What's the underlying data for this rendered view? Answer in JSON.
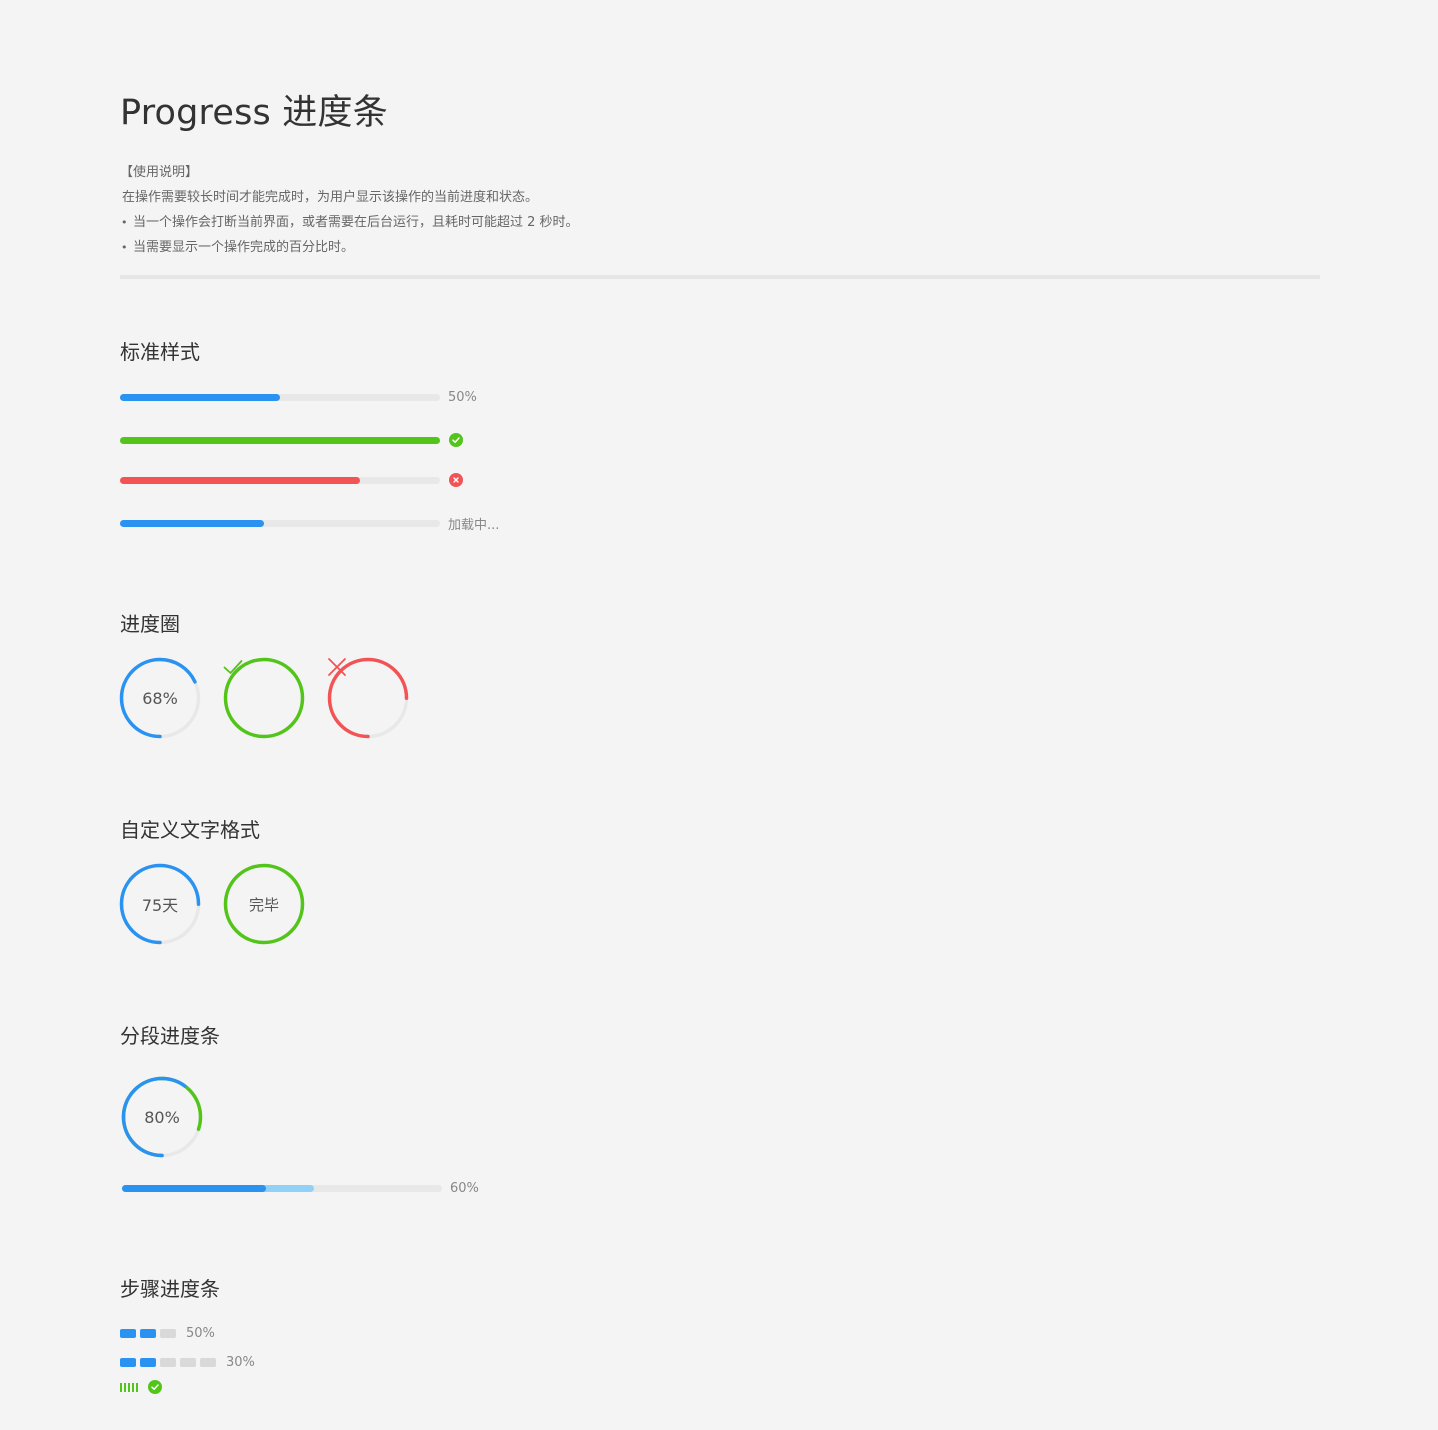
{
  "page_title": "Progress 进度条",
  "usage": {
    "heading": "【使用说明】",
    "line1": "在操作需要较长时间才能完成时，为用户显示该操作的当前进度和状态。",
    "bullets": [
      "当一个操作会打断当前界面，或者需要在后台运行，且耗时可能超过 2 秒时。",
      "当需要显示一个操作完成的百分比时。"
    ]
  },
  "colors": {
    "primary": "#2a92f0",
    "success": "#52c41a",
    "error": "#f25455",
    "light_primary": "#91d0f7",
    "track": "#e8e8e9",
    "step_inactive": "#d9d9d9"
  },
  "sections": {
    "standard": {
      "title": "标准样式",
      "bars": [
        {
          "percent": 50,
          "status": "normal",
          "label": "50%"
        },
        {
          "percent": 100,
          "status": "success",
          "icon": "check-circle-icon"
        },
        {
          "percent": 75,
          "status": "error",
          "icon": "close-circle-icon"
        },
        {
          "percent": 45,
          "status": "active",
          "label": "加载中..."
        }
      ]
    },
    "circle": {
      "title": "进度圈",
      "items": [
        {
          "percent": 68,
          "status": "normal",
          "label": "68%"
        },
        {
          "percent": 100,
          "status": "success",
          "icon": "check-icon"
        },
        {
          "percent": 75,
          "status": "error",
          "icon": "close-icon"
        }
      ]
    },
    "custom_format": {
      "title": "自定义文字格式",
      "items": [
        {
          "percent": 75,
          "label": "75天"
        },
        {
          "percent": 100,
          "label": "完毕"
        }
      ]
    },
    "segmented": {
      "title": "分段进度条",
      "circle": {
        "percent": 80,
        "success_percent": 60,
        "label": "80%"
      },
      "bar": {
        "percent": 60,
        "success_percent": 45,
        "label": "60%"
      }
    },
    "steps": {
      "title": "步骤进度条",
      "rows": [
        {
          "steps": 3,
          "active": 2,
          "label": "50%"
        },
        {
          "steps": 5,
          "active": 2,
          "label": "30%"
        },
        {
          "steps": 5,
          "active": 5,
          "status": "success",
          "icon": "check-circle-icon"
        }
      ]
    }
  }
}
